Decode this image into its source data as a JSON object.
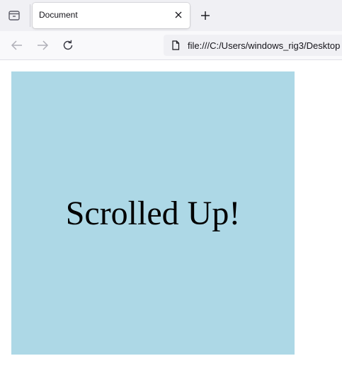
{
  "browser": {
    "tab": {
      "title": "Document"
    },
    "address_bar": {
      "url": "file:///C:/Users/windows_rig3/Desktop"
    },
    "icons": {
      "tab_overview": "tab-overview-icon",
      "close": "close-icon",
      "new_tab": "plus-icon",
      "back": "back-arrow-icon",
      "forward": "forward-arrow-icon",
      "reload": "reload-icon",
      "page": "page-icon"
    }
  },
  "page": {
    "box_text": "Scrolled Up!",
    "box_color": "#add8e6"
  }
}
